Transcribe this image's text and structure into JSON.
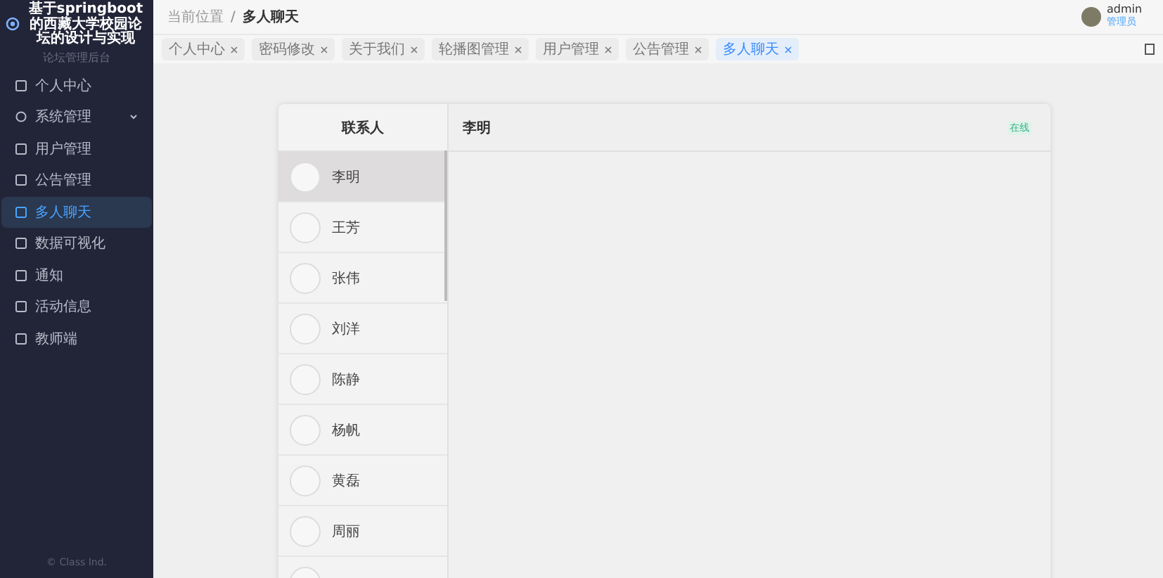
{
  "sidebar": {
    "title": "基于springboot的西藏大学校园论坛的设计与实现",
    "subtitle": "论坛管理后台",
    "items": [
      {
        "label": "个人中心",
        "kind": "page",
        "selected": false
      },
      {
        "label": "系统管理",
        "kind": "group",
        "selected": false
      },
      {
        "label": "用户管理",
        "kind": "page",
        "selected": false
      },
      {
        "label": "公告管理",
        "kind": "page",
        "selected": false
      },
      {
        "label": "多人聊天",
        "kind": "page",
        "selected": true
      },
      {
        "label": "数据可视化",
        "kind": "page",
        "selected": false
      },
      {
        "label": "通知",
        "kind": "page",
        "selected": false
      },
      {
        "label": "活动信息",
        "kind": "page",
        "selected": false
      },
      {
        "label": "教师端",
        "kind": "page",
        "selected": false
      }
    ],
    "footer": "© Class Ind."
  },
  "header": {
    "separator": "/",
    "breadcrumb": [
      "当前位置",
      "多人聊天"
    ],
    "user": {
      "name": "admin",
      "role": "管理员"
    }
  },
  "tabs": [
    {
      "label": "个人中心",
      "selected": false
    },
    {
      "label": "密码修改",
      "selected": false
    },
    {
      "label": "关于我们",
      "selected": false
    },
    {
      "label": "轮播图管理",
      "selected": false
    },
    {
      "label": "用户管理",
      "selected": false
    },
    {
      "label": "公告管理",
      "selected": false
    },
    {
      "label": "多人聊天",
      "selected": true
    }
  ],
  "contacts": {
    "title": "联系人",
    "items": [
      {
        "name": "李明",
        "selected": true
      },
      {
        "name": "王芳",
        "selected": false
      },
      {
        "name": "张伟",
        "selected": false
      },
      {
        "name": "刘洋",
        "selected": false
      },
      {
        "name": "陈静",
        "selected": false
      },
      {
        "name": "杨帆",
        "selected": false
      },
      {
        "name": "黄磊",
        "selected": false
      },
      {
        "name": "周丽",
        "selected": false
      },
      {
        "selected": false
      }
    ]
  },
  "chat": {
    "title": "李明",
    "status": "在线"
  }
}
